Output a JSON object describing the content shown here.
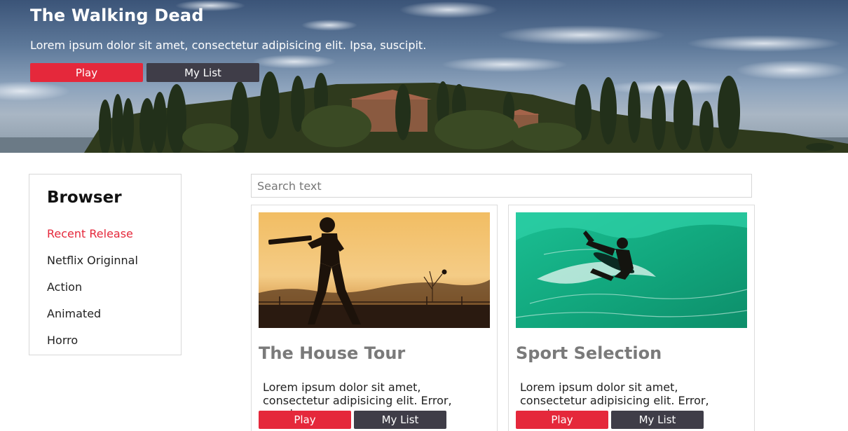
{
  "hero": {
    "title": "The Walking Dead",
    "description": "Lorem ipsum dolor sit amet, consectetur adipisicing elit. Ipsa, suscipit.",
    "play_label": "Play",
    "mylist_label": "My List"
  },
  "sidebar": {
    "title": "Browser",
    "items": [
      {
        "label": "Recent Release",
        "active": true
      },
      {
        "label": "Netflix Originnal",
        "active": false
      },
      {
        "label": "Action",
        "active": false
      },
      {
        "label": "Animated",
        "active": false
      },
      {
        "label": "Horro",
        "active": false
      }
    ]
  },
  "search": {
    "placeholder": "Search text",
    "value": ""
  },
  "cards": [
    {
      "title": "The House Tour",
      "description": "Lorem ipsum dolor sit amet, consectetur adipisicing elit. Error, sequi.",
      "play_label": "Play",
      "mylist_label": "My List",
      "image": "cricket-silhouette"
    },
    {
      "title": "Sport Selection",
      "description": "Lorem ipsum dolor sit amet, consectetur adipisicing elit. Error, sequi.",
      "play_label": "Play",
      "mylist_label": "My List",
      "image": "surfer-wave"
    }
  ],
  "colors": {
    "accent_red": "#e5283b",
    "dark_button": "#3f3d48",
    "card_title_gray": "#7a7a7a"
  }
}
